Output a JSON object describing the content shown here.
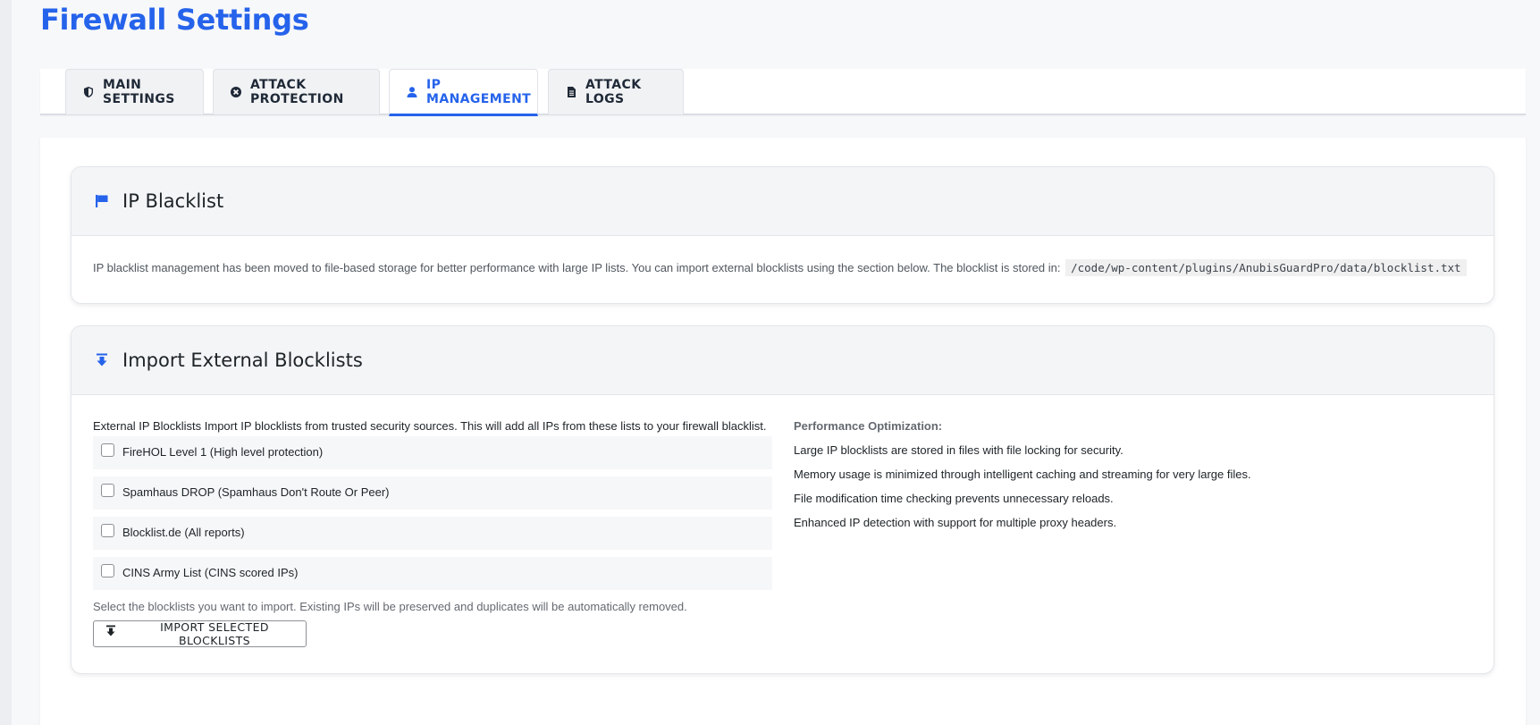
{
  "page": {
    "title": "Firewall Settings"
  },
  "tabs": [
    {
      "label": "MAIN SETTINGS",
      "icon": "shield-icon"
    },
    {
      "label": "ATTACK PROTECTION",
      "icon": "dismiss-circle-icon"
    },
    {
      "label": "IP MANAGEMENT",
      "icon": "user-icon",
      "active": true
    },
    {
      "label": "ATTACK LOGS",
      "icon": "document-icon"
    }
  ],
  "blacklist": {
    "title": "IP Blacklist",
    "icon": "flag-icon",
    "description": "IP blacklist management has been moved to file-based storage for better performance with large IP lists. You can import external blocklists using the section below. The blocklist is stored in:",
    "path": "/code/wp-content/plugins/AnubisGuardPro/data/blocklist.txt"
  },
  "import": {
    "title": "Import External Blocklists",
    "icon": "download-icon",
    "intro": "External IP Blocklists Import IP blocklists from trusted security sources. This will add all IPs from these lists to your firewall blacklist.",
    "options": [
      {
        "label": "FireHOL Level 1 (High level protection)",
        "checked": false
      },
      {
        "label": "Spamhaus DROP (Spamhaus Don't Route Or Peer)",
        "checked": false
      },
      {
        "label": "Blocklist.de (All reports)",
        "checked": false
      },
      {
        "label": "CINS Army List (CINS scored IPs)",
        "checked": false
      }
    ],
    "help": "Select the blocklists you want to import. Existing IPs will be preserved and duplicates will be automatically removed.",
    "button_label": "IMPORT SELECTED BLOCKLISTS",
    "performance": {
      "title": "Performance Optimization:",
      "items": [
        "Large IP blocklists are stored in files with file locking for security.",
        "Memory usage is minimized through intelligent caching and streaming for very large files.",
        "File modification time checking prevents unnecessary reloads.",
        "Enhanced IP detection with support for multiple proxy headers."
      ]
    }
  },
  "colors": {
    "accent": "#2563eb",
    "text": "#1d2327",
    "muted": "#646970"
  }
}
